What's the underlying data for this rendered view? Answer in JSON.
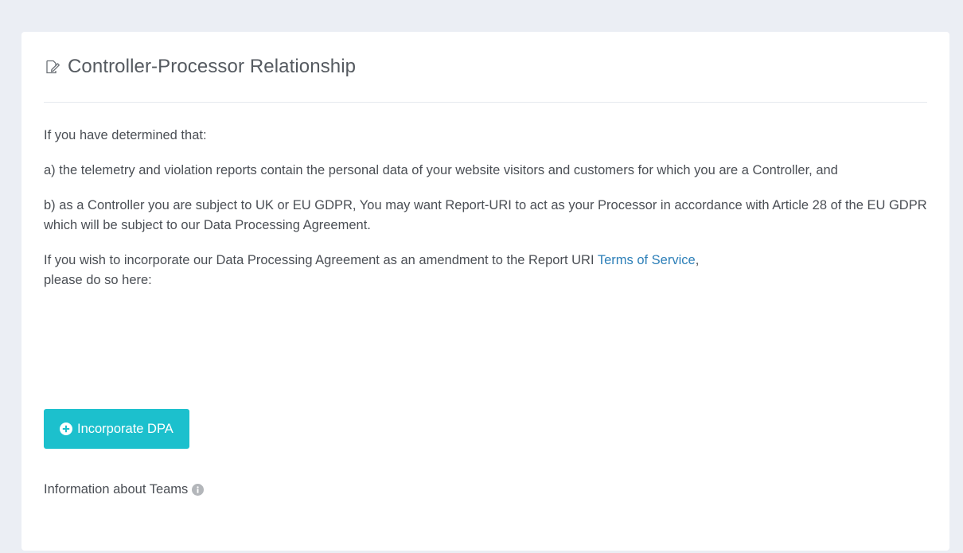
{
  "card": {
    "title": "Controller-Processor Relationship",
    "header_icon": "edit-document-icon"
  },
  "body": {
    "intro": "If you have determined that:",
    "point_a": "a) the telemetry and violation reports contain the personal data of your website visitors and customers for which you are a Controller, and",
    "point_b": "b) as a Controller you are subject to UK or EU GDPR, You may want Report-URI to act as your Processor in accordance with Article 28 of the EU GDPR which will be subject to our Data Processing Agreement.",
    "incorporate_prefix": "If you wish to incorporate our Data Processing Agreement as an amendment to the Report URI ",
    "terms_link": "Terms of Service",
    "incorporate_suffix": ",",
    "incorporate_line2": "please do so here:"
  },
  "button": {
    "label": "Incorporate DPA",
    "icon": "plus-circle-icon"
  },
  "teams": {
    "label": "Information about Teams",
    "icon": "info-circle-icon"
  },
  "colors": {
    "background": "#ebeef4",
    "card": "#ffffff",
    "accent": "#1cc0cd",
    "link": "#2c7fb8"
  }
}
